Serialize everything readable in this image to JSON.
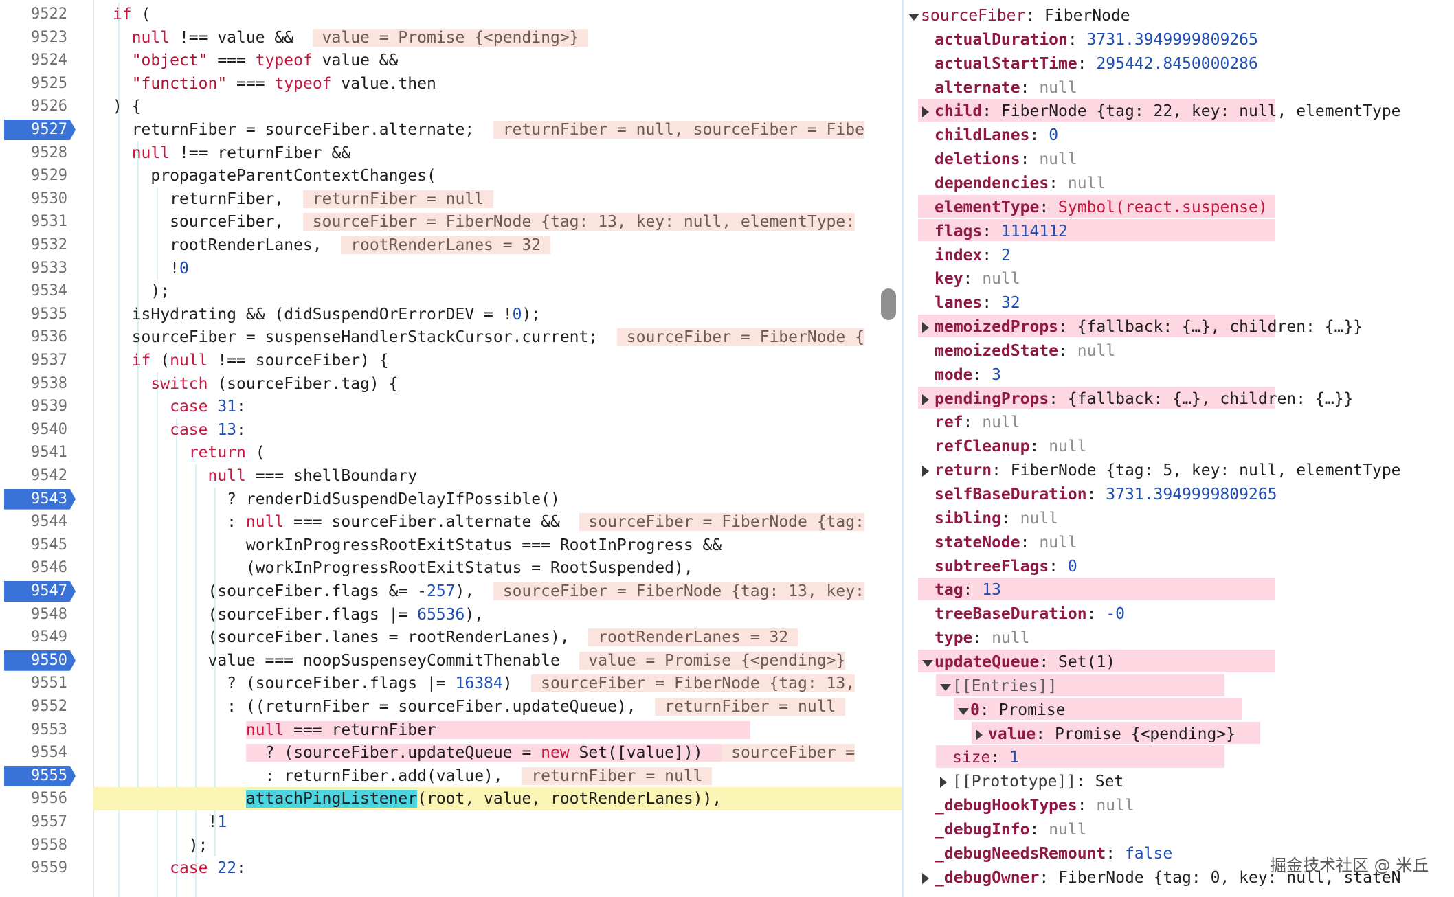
{
  "colors": {
    "breakpoint": "#3a73d8",
    "current_line": "#fbf5b5",
    "inline_value_bg": "#fbe3de",
    "highlight_pink": "#fdd8e2",
    "keyword": "#c8173f",
    "number": "#1d4fb6",
    "property_key": "#8f1845"
  },
  "editor": {
    "lines": [
      {
        "n": "9522",
        "bp": false,
        "html": "<span class=\"kw\">if</span> ("
      },
      {
        "n": "9523",
        "bp": false,
        "html": "  <span class=\"kw\">null</span> !== value &&  <span class=\"ann\"> value = Promise {&lt;pending&gt;} </span>"
      },
      {
        "n": "9524",
        "bp": false,
        "html": "  <span class=\"str\">\"object\"</span> === <span class=\"kw\">typeof</span> value &&"
      },
      {
        "n": "9525",
        "bp": false,
        "html": "  <span class=\"str\">\"function\"</span> === <span class=\"kw\">typeof</span> value.then"
      },
      {
        "n": "9526",
        "bp": false,
        "html": ") {"
      },
      {
        "n": "9527",
        "bp": true,
        "html": "  returnFiber = sourceFiber.alternate;  <span class=\"ann\"> returnFiber = null, sourceFiber = Fibe</span>"
      },
      {
        "n": "9528",
        "bp": false,
        "html": "  <span class=\"kw\">null</span> !== returnFiber &&"
      },
      {
        "n": "9529",
        "bp": false,
        "html": "    propagateParentContextChanges("
      },
      {
        "n": "9530",
        "bp": false,
        "html": "      returnFiber,  <span class=\"ann\"> returnFiber = null </span>"
      },
      {
        "n": "9531",
        "bp": false,
        "html": "      sourceFiber,  <span class=\"ann\"> sourceFiber = FiberNode {tag: 13, key: null, elementType:</span>"
      },
      {
        "n": "9532",
        "bp": false,
        "html": "      rootRenderLanes,  <span class=\"ann\"> rootRenderLanes = 32 </span>"
      },
      {
        "n": "9533",
        "bp": false,
        "html": "      !<span class=\"num\">0</span>"
      },
      {
        "n": "9534",
        "bp": false,
        "html": "    );"
      },
      {
        "n": "9535",
        "bp": false,
        "html": "  isHydrating && (didSuspendOrErrorDEV = !<span class=\"num\">0</span>);"
      },
      {
        "n": "9536",
        "bp": false,
        "html": "  sourceFiber = suspenseHandlerStackCursor.current;  <span class=\"ann\"> sourceFiber = FiberNode {</span>"
      },
      {
        "n": "9537",
        "bp": false,
        "html": "  <span class=\"kw\">if</span> (<span class=\"kw\">null</span> !== sourceFiber) {"
      },
      {
        "n": "9538",
        "bp": false,
        "html": "    <span class=\"kw\">switch</span> (sourceFiber.tag) {"
      },
      {
        "n": "9539",
        "bp": false,
        "html": "      <span class=\"kw\">case</span> <span class=\"num\">31</span>:"
      },
      {
        "n": "9540",
        "bp": false,
        "html": "      <span class=\"kw\">case</span> <span class=\"num\">13</span>:"
      },
      {
        "n": "9541",
        "bp": false,
        "html": "        <span class=\"kw\">return</span> ("
      },
      {
        "n": "9542",
        "bp": false,
        "html": "          <span class=\"kw\">null</span> === shellBoundary"
      },
      {
        "n": "9543",
        "bp": true,
        "html": "            ? renderDidSuspendDelayIfPossible()"
      },
      {
        "n": "9544",
        "bp": false,
        "html": "            : <span class=\"kw\">null</span> === sourceFiber.alternate &&  <span class=\"ann\"> sourceFiber = FiberNode {tag:</span>"
      },
      {
        "n": "9545",
        "bp": false,
        "html": "              workInProgressRootExitStatus === RootInProgress &&"
      },
      {
        "n": "9546",
        "bp": false,
        "html": "              (workInProgressRootExitStatus = RootSuspended),"
      },
      {
        "n": "9547",
        "bp": true,
        "html": "          (sourceFiber.flags &= -<span class=\"num\">257</span>),  <span class=\"ann\"> sourceFiber = FiberNode {tag: 13, key:</span>"
      },
      {
        "n": "9548",
        "bp": false,
        "html": "          (sourceFiber.flags |= <span class=\"num\">65536</span>),"
      },
      {
        "n": "9549",
        "bp": false,
        "html": "          (sourceFiber.lanes = rootRenderLanes),  <span class=\"ann\"> rootRenderLanes = 32 </span>"
      },
      {
        "n": "9550",
        "bp": true,
        "html": "          value === noopSuspenseyCommitThenable  <span class=\"ann\"> value = Promise {&lt;pending&gt;}</span>"
      },
      {
        "n": "9551",
        "bp": false,
        "html": "            ? (sourceFiber.flags |= <span class=\"num\">16384</span>)  <span class=\"ann\"> sourceFiber = FiberNode {tag: 13,</span>"
      },
      {
        "n": "9552",
        "bp": false,
        "html": "            : ((returnFiber = sourceFiber.updateQueue),  <span class=\"ann\"> returnFiber = null </span>"
      },
      {
        "n": "9553",
        "bp": false,
        "html": "              <span class=\"hl-pink\"><span class=\"kw\">null</span> === returnFiber                                 </span>"
      },
      {
        "n": "9554",
        "bp": false,
        "html": "              <span class=\"hl-pink\">  ? (sourceFiber.updateQueue = <span class=\"kw\">new</span> Set([value]))  </span><span class=\"ann\"> sourceFiber =</span>"
      },
      {
        "n": "9555",
        "bp": true,
        "html": "                : returnFiber.add(value),  <span class=\"ann\"> returnFiber = null </span>"
      },
      {
        "n": "9556",
        "bp": false,
        "html": "              <span class=\"hl-cyan\">attachPingListener</span>(root, value, rootRenderLanes)),",
        "current": true
      },
      {
        "n": "9557",
        "bp": false,
        "html": "          !<span class=\"num\">1</span>"
      },
      {
        "n": "9558",
        "bp": false,
        "html": "        );"
      },
      {
        "n": "9559",
        "bp": false,
        "html": "      <span class=\"kw\">case</span> <span class=\"num\">22</span>:"
      }
    ]
  },
  "scope": {
    "rows": [
      {
        "tri": "down",
        "indent": 0,
        "key": "sourceFiber",
        "sep": ": ",
        "val": "FiberNode",
        "vclass": "",
        "plainkey": true
      },
      {
        "tri": "",
        "indent": 1,
        "key": "actualDuration",
        "sep": ": ",
        "val": "3731.3949999809265",
        "vclass": "v-num"
      },
      {
        "tri": "",
        "indent": 1,
        "key": "actualStartTime",
        "sep": ": ",
        "val": "295442.8450000286",
        "vclass": "v-num"
      },
      {
        "tri": "",
        "indent": 1,
        "key": "alternate",
        "sep": ": ",
        "val": "null",
        "vclass": "v-null"
      },
      {
        "tri": "right",
        "indent": 1,
        "key": "child",
        "sep": ": ",
        "val": "FiberNode {tag: 22, key: null, elementType",
        "vclass": "",
        "hl": true
      },
      {
        "tri": "",
        "indent": 1,
        "key": "childLanes",
        "sep": ": ",
        "val": "0",
        "vclass": "v-num"
      },
      {
        "tri": "",
        "indent": 1,
        "key": "deletions",
        "sep": ": ",
        "val": "null",
        "vclass": "v-null"
      },
      {
        "tri": "",
        "indent": 1,
        "key": "dependencies",
        "sep": ": ",
        "val": "null",
        "vclass": "v-null"
      },
      {
        "tri": "",
        "indent": 1,
        "key": "elementType",
        "sep": ": ",
        "val": "Symbol(react.suspense)",
        "vclass": "v-sym",
        "hl": true
      },
      {
        "tri": "",
        "indent": 1,
        "key": "flags",
        "sep": ": ",
        "val": "1114112",
        "vclass": "v-num",
        "hl": true
      },
      {
        "tri": "",
        "indent": 1,
        "key": "index",
        "sep": ": ",
        "val": "2",
        "vclass": "v-num"
      },
      {
        "tri": "",
        "indent": 1,
        "key": "key",
        "sep": ": ",
        "val": "null",
        "vclass": "v-null"
      },
      {
        "tri": "",
        "indent": 1,
        "key": "lanes",
        "sep": ": ",
        "val": "32",
        "vclass": "v-num"
      },
      {
        "tri": "right",
        "indent": 1,
        "key": "memoizedProps",
        "sep": ": ",
        "val": "{fallback: {…}, children: {…}}",
        "vclass": "",
        "hl": true
      },
      {
        "tri": "",
        "indent": 1,
        "key": "memoizedState",
        "sep": ": ",
        "val": "null",
        "vclass": "v-null"
      },
      {
        "tri": "",
        "indent": 1,
        "key": "mode",
        "sep": ": ",
        "val": "3",
        "vclass": "v-num"
      },
      {
        "tri": "right",
        "indent": 1,
        "key": "pendingProps",
        "sep": ": ",
        "val": "{fallback: {…}, children: {…}}",
        "vclass": "",
        "hl": true
      },
      {
        "tri": "",
        "indent": 1,
        "key": "ref",
        "sep": ": ",
        "val": "null",
        "vclass": "v-null"
      },
      {
        "tri": "",
        "indent": 1,
        "key": "refCleanup",
        "sep": ": ",
        "val": "null",
        "vclass": "v-null"
      },
      {
        "tri": "right",
        "indent": 1,
        "key": "return",
        "sep": ": ",
        "val": "FiberNode {tag: 5, key: null, elementType",
        "vclass": ""
      },
      {
        "tri": "",
        "indent": 1,
        "key": "selfBaseDuration",
        "sep": ": ",
        "val": "3731.3949999809265",
        "vclass": "v-num"
      },
      {
        "tri": "",
        "indent": 1,
        "key": "sibling",
        "sep": ": ",
        "val": "null",
        "vclass": "v-null"
      },
      {
        "tri": "",
        "indent": 1,
        "key": "stateNode",
        "sep": ": ",
        "val": "null",
        "vclass": "v-null"
      },
      {
        "tri": "",
        "indent": 1,
        "key": "subtreeFlags",
        "sep": ": ",
        "val": "0",
        "vclass": "v-num"
      },
      {
        "tri": "",
        "indent": 1,
        "key": "tag",
        "sep": ": ",
        "val": "13",
        "vclass": "v-num",
        "hl": true
      },
      {
        "tri": "",
        "indent": 1,
        "key": "treeBaseDuration",
        "sep": ": ",
        "val": "-0",
        "vclass": "v-num"
      },
      {
        "tri": "",
        "indent": 1,
        "key": "type",
        "sep": ": ",
        "val": "null",
        "vclass": "v-null"
      },
      {
        "tri": "down",
        "indent": 1,
        "key": "updateQueue",
        "sep": ": ",
        "val": "Set(1)",
        "vclass": "",
        "hl": true
      },
      {
        "tri": "down",
        "indent": 2,
        "key": "[[Entries]]",
        "sep": "",
        "val": "",
        "vclass": "",
        "nokey": true,
        "hl": true
      },
      {
        "tri": "down",
        "indent": 3,
        "key": "0",
        "sep": ": ",
        "val": "Promise",
        "vclass": "",
        "hl": true
      },
      {
        "tri": "right",
        "indent": 4,
        "key": "value",
        "sep": ": ",
        "val": "Promise {<pending>}",
        "vclass": "",
        "hl": true
      },
      {
        "tri": "",
        "indent": 2,
        "key": "size",
        "sep": ": ",
        "val": "1",
        "vclass": "v-num",
        "hl": true,
        "plainkey": true
      },
      {
        "tri": "right",
        "indent": 2,
        "key": "[[Prototype]]",
        "sep": ": ",
        "val": "Set",
        "vclass": "",
        "nokeystyle": true
      },
      {
        "tri": "",
        "indent": 1,
        "key": "_debugHookTypes",
        "sep": ": ",
        "val": "null",
        "vclass": "v-null"
      },
      {
        "tri": "",
        "indent": 1,
        "key": "_debugInfo",
        "sep": ": ",
        "val": "null",
        "vclass": "v-null"
      },
      {
        "tri": "",
        "indent": 1,
        "key": "_debugNeedsRemount",
        "sep": ": ",
        "val": "false",
        "vclass": "v-bool"
      },
      {
        "tri": "right",
        "indent": 1,
        "key": "_debugOwner",
        "sep": ": ",
        "val": "FiberNode {tag: 0, key: null, stateN",
        "vclass": ""
      }
    ]
  },
  "watermark": "掘金技术社区 @ 米丘"
}
